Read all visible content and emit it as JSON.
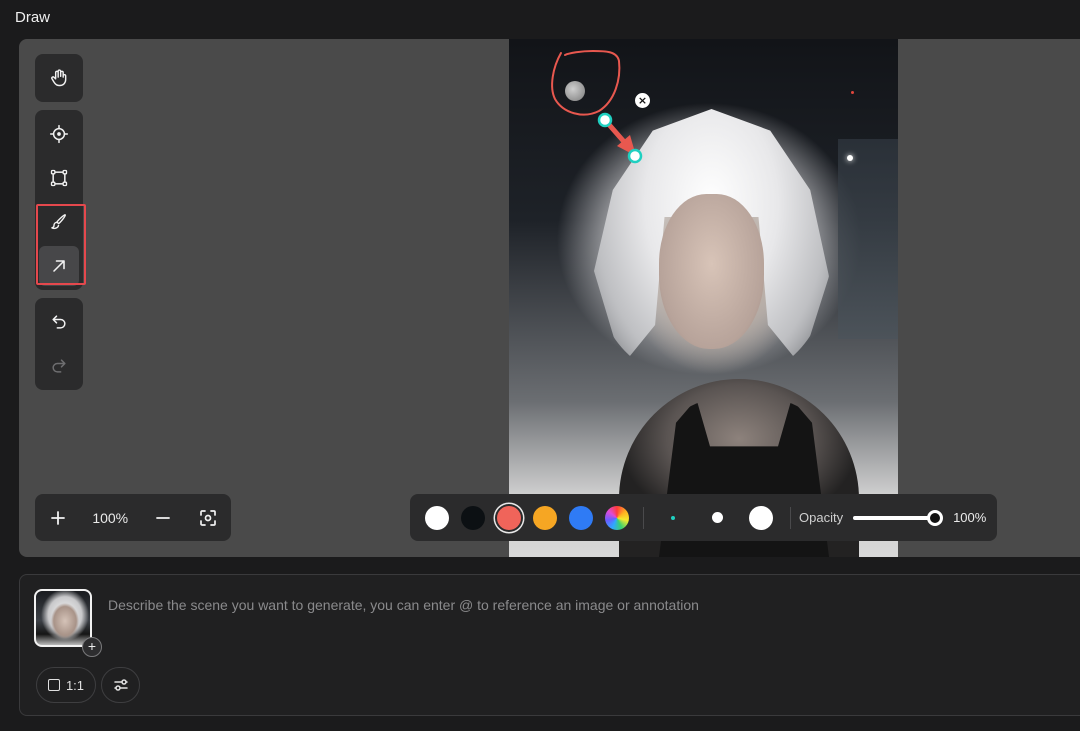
{
  "app": {
    "title": "Draw"
  },
  "toolbar": {
    "tools": [
      {
        "name": "hand",
        "icon": "hand-icon"
      },
      {
        "name": "target",
        "icon": "crosshair-icon"
      },
      {
        "name": "select-box",
        "icon": "bounding-box-icon"
      },
      {
        "name": "brush",
        "icon": "brush-icon"
      },
      {
        "name": "arrow",
        "icon": "arrow-icon",
        "active": true
      },
      {
        "name": "undo",
        "icon": "undo-icon"
      },
      {
        "name": "redo",
        "icon": "redo-icon",
        "disabled": true
      }
    ]
  },
  "zoom": {
    "value": "100%",
    "zoom_in_icon": "plus-icon",
    "zoom_out_icon": "minus-icon",
    "fit_icon": "fit-screen-icon"
  },
  "style_bar": {
    "colors": [
      "#ffffff",
      "#0c1013",
      "#f0645a",
      "#f6a623",
      "#2f7bf5",
      "rainbow"
    ],
    "selected_color": "#f0645a",
    "opacity_label": "Opacity",
    "opacity_value": "100%",
    "opacity_level": 1.0
  },
  "annotation": {
    "stroke_color": "#e8584f",
    "handle_color": "#1fd0c1",
    "delete_label": "×"
  },
  "prompt": {
    "placeholder": "Describe the scene you want to generate, you can enter @ to reference an image or annotation",
    "add_label": "+",
    "ratio_label": "1:1",
    "settings_icon": "sliders-icon"
  }
}
